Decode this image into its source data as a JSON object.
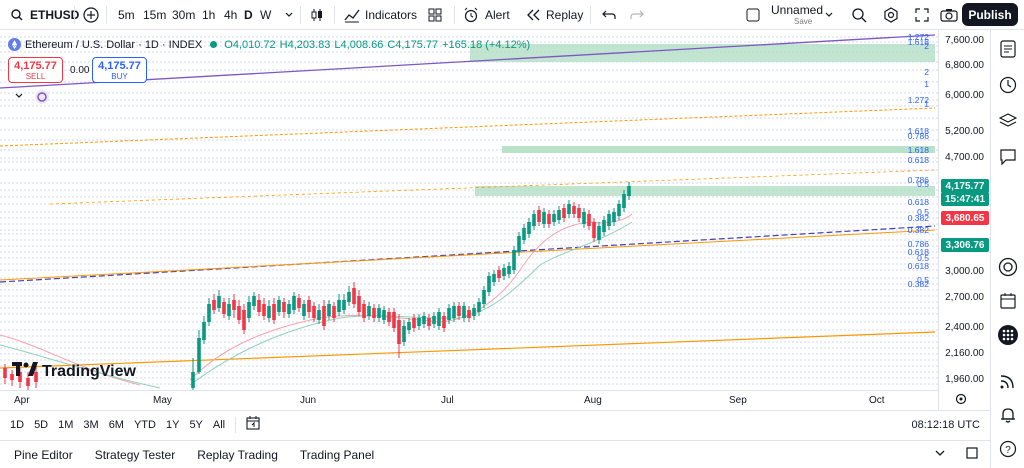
{
  "toolbar": {
    "symbol": "ETHUSD",
    "intervals": [
      "5m",
      "15m",
      "30m",
      "1h",
      "4h",
      "D",
      "W"
    ],
    "active_interval": "D",
    "indicators_label": "Indicators",
    "alert_label": "Alert",
    "replay_label": "Replay",
    "layout_name": "Unnamed",
    "layout_sub": "Save",
    "publish_label": "Publish"
  },
  "legend": {
    "title": "Ethereum / U.S. Dollar · 1D · INDEX",
    "o": "O4,010.72",
    "h": "H4,203.83",
    "l": "L4,008.66",
    "c": "C4,175.77",
    "change": "+165.18 (+4.12%)"
  },
  "trade": {
    "sell_price": "4,175.77",
    "sell_label": "SELL",
    "spread": "0.00",
    "buy_price": "4,175.77",
    "buy_label": "BUY"
  },
  "price_axis": {
    "labels": [
      "7,600.00",
      "6,800.00",
      "6,000.00",
      "5,200.00",
      "4,700.00",
      "3,000.00",
      "2,700.00",
      "2,400.00",
      "2,160.00",
      "1,960.00"
    ],
    "current_price": "4,175.77",
    "countdown": "15:47:41",
    "level_red": "3,680.65",
    "level_green": "3,306.76"
  },
  "fib_labels": [
    "1.272",
    "1.618",
    "2",
    "2",
    "1",
    "1.272",
    "1",
    "1.618",
    "0.786",
    "1.618",
    "0.618",
    "0.786",
    "0.5",
    "0.618",
    "0.5",
    "0.382",
    "0.382",
    "0.786",
    "0.618",
    "0.5",
    "0.618",
    "0.5",
    "0.382"
  ],
  "time_axis": [
    "Apr",
    "May",
    "Jun",
    "Jul",
    "Aug",
    "Sep",
    "Oct"
  ],
  "range_buttons": [
    "1D",
    "5D",
    "1M",
    "3M",
    "6M",
    "YTD",
    "1Y",
    "5Y",
    "All"
  ],
  "clock": "08:12:18 UTC",
  "bottom_tabs": [
    "Pine Editor",
    "Strategy Tester",
    "Replay Trading",
    "Trading Panel"
  ],
  "brand": "TradingView",
  "colors": {
    "up": "#089981",
    "down": "#f23645",
    "accent": "#2962ff",
    "fib_green": "#b2dfc4",
    "ma_fast": "#f7a1a8",
    "ma_slow": "#8fd1b4",
    "trend_purple": "#7e57c2",
    "trend_orange": "#ff9800"
  }
}
